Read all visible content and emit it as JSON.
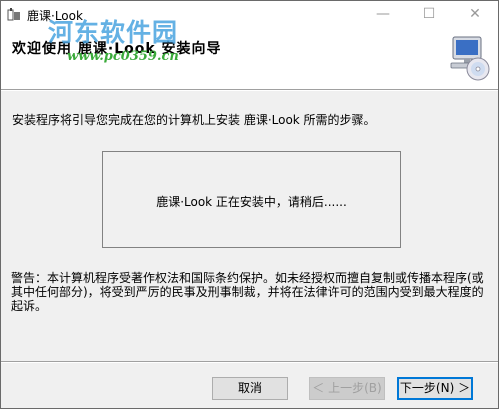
{
  "window": {
    "title": "鹿课·Look",
    "watermark_text": "河东软件园",
    "watermark_url": "www.pc0359.cn",
    "controls": {
      "minimize": "—",
      "maximize": "☐",
      "close": "✕"
    }
  },
  "header": {
    "title": "欢迎使用 鹿课·Look 安装向导"
  },
  "body": {
    "intro": "安装程序将引导您完成在您的计算机上安装 鹿课·Look 所需的步骤。",
    "status": "鹿课·Look 正在安装中，请稍后......",
    "warning": "警告：本计算机程序受著作权法和国际条约保护。如未经授权而擅自复制或传播本程序(或其中任何部分)，将受到严厉的民事及刑事制裁，并将在法律许可的范围内受到最大程度的起诉。"
  },
  "buttons": {
    "cancel": "取消",
    "back": "＜ 上一步(B)",
    "next": "下一步(N) ＞"
  },
  "colors": {
    "accent": "#0078d7",
    "watermark": "#4aa4e0",
    "watermark_url": "#3aaa3a"
  }
}
